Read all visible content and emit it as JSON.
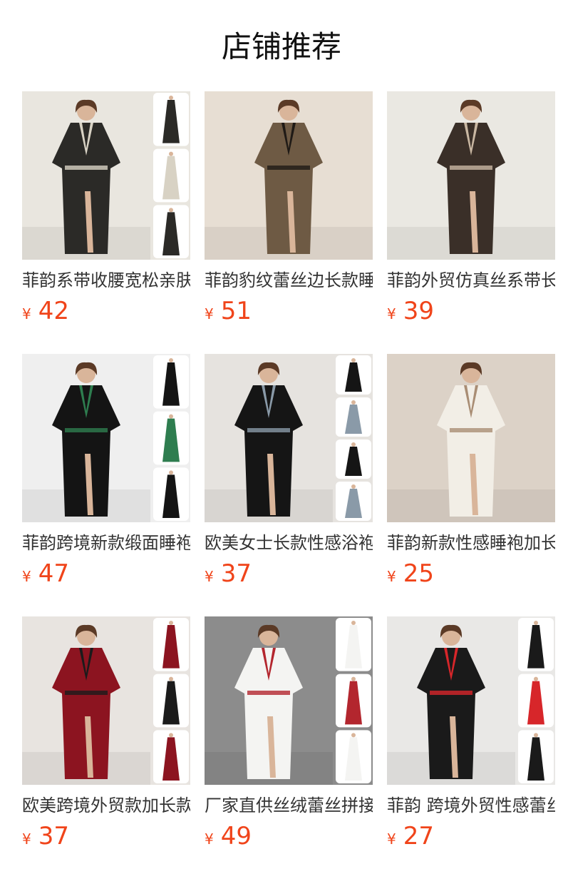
{
  "header": {
    "title": "店铺推荐"
  },
  "products": [
    {
      "name": "菲韵系带收腰宽松亲肤",
      "currency": "¥",
      "price": "42",
      "robe_color": "#2b2a27",
      "accent_color": "#d8d2c4",
      "bg_color": "#e9e6df"
    },
    {
      "name": "菲韵豹纹蕾丝边长款睡",
      "currency": "¥",
      "price": "51",
      "robe_color": "#6e5a44",
      "accent_color": "#1f1a16",
      "bg_color": "#e7ded3"
    },
    {
      "name": "菲韵外贸仿真丝系带长",
      "currency": "¥",
      "price": "39",
      "robe_color": "#3a2f28",
      "accent_color": "#c9b7a2",
      "bg_color": "#eae8e2"
    },
    {
      "name": "菲韵跨境新款缎面睡袍",
      "currency": "¥",
      "price": "47",
      "robe_color": "#141414",
      "accent_color": "#2e7d4f",
      "bg_color": "#efefef"
    },
    {
      "name": "欧美女士长款性感浴袍",
      "currency": "¥",
      "price": "37",
      "robe_color": "#151515",
      "accent_color": "#8a9aa8",
      "bg_color": "#e6e3df"
    },
    {
      "name": "菲韵新款性感睡袍加长",
      "currency": "¥",
      "price": "25",
      "robe_color": "#f2eee6",
      "accent_color": "#a98d74",
      "bg_color": "#dcd2c7"
    },
    {
      "name": "欧美跨境外贸款加长款",
      "currency": "¥",
      "price": "37",
      "robe_color": "#8c1420",
      "accent_color": "#1b1b1b",
      "bg_color": "#e8e4e0"
    },
    {
      "name": "厂家直供丝绒蕾丝拼接",
      "currency": "¥",
      "price": "49",
      "robe_color": "#f4f4f2",
      "accent_color": "#b3262e",
      "bg_color": "#8c8c8c"
    },
    {
      "name": "菲韵 跨境外贸性感蕾丝",
      "currency": "¥",
      "price": "27",
      "robe_color": "#1a1a1a",
      "accent_color": "#d7262a",
      "bg_color": "#e9e8e6"
    }
  ]
}
